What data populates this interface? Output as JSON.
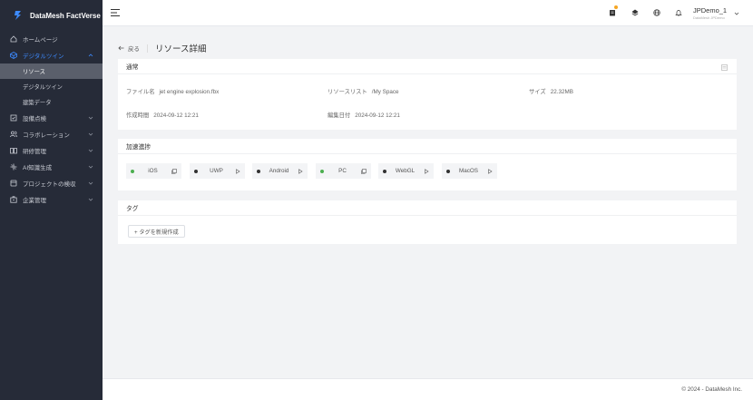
{
  "brand": {
    "name": "DataMesh FactVerse"
  },
  "sidebar": {
    "items": [
      {
        "label": "ホームページ",
        "icon": "home-icon",
        "has_children": false
      },
      {
        "label": "デジタルツイン",
        "icon": "cube-icon",
        "has_children": true,
        "expanded": true,
        "children": [
          {
            "label": "リソース",
            "selected": true
          },
          {
            "label": "デジタルツイン",
            "selected": false
          },
          {
            "label": "建築データ",
            "selected": false
          }
        ]
      },
      {
        "label": "設備点検",
        "icon": "checklist-icon",
        "has_children": true
      },
      {
        "label": "コラボレーション",
        "icon": "users-icon",
        "has_children": true
      },
      {
        "label": "研修管理",
        "icon": "book-icon",
        "has_children": true
      },
      {
        "label": "AI知識生成",
        "icon": "ai-icon",
        "has_children": true
      },
      {
        "label": "プロジェクトの検収",
        "icon": "project-icon",
        "has_children": true
      },
      {
        "label": "企業管理",
        "icon": "building-icon",
        "has_children": true
      }
    ]
  },
  "header": {
    "user_name": "JPDemo_1",
    "user_sub": "DataMesh JPDemo",
    "accent_badge": "#f5a623"
  },
  "page": {
    "back_label": "戻る",
    "title": "リソース詳細"
  },
  "general": {
    "title": "通常",
    "fields": [
      {
        "label": "ファイル名",
        "value": "jet engine explosion.fbx"
      },
      {
        "label": "リソースリスト",
        "value": "/My Space"
      },
      {
        "label": "サイズ",
        "value": "22.32MB"
      },
      {
        "label": "作成時間",
        "value": "2024-09-12 12:21"
      },
      {
        "label": "編集日付",
        "value": "2024-09-12 12:21"
      }
    ]
  },
  "progress": {
    "title": "加速進捗",
    "platforms": [
      {
        "name": "iOS",
        "status": "ready",
        "color": "#4caf50",
        "action": "copy-icon"
      },
      {
        "name": "UWP",
        "status": "pending",
        "color": "#333333",
        "action": "play-icon"
      },
      {
        "name": "Android",
        "status": "pending",
        "color": "#333333",
        "action": "play-icon"
      },
      {
        "name": "PC",
        "status": "ready",
        "color": "#4caf50",
        "action": "copy-icon"
      },
      {
        "name": "WebGL",
        "status": "pending",
        "color": "#333333",
        "action": "play-icon"
      },
      {
        "name": "MacOS",
        "status": "pending",
        "color": "#333333",
        "action": "play-icon"
      }
    ]
  },
  "tags": {
    "title": "タグ",
    "add_label": "+ タグを新規作成"
  },
  "footer": {
    "text": "© 2024 - DataMesh Inc."
  }
}
